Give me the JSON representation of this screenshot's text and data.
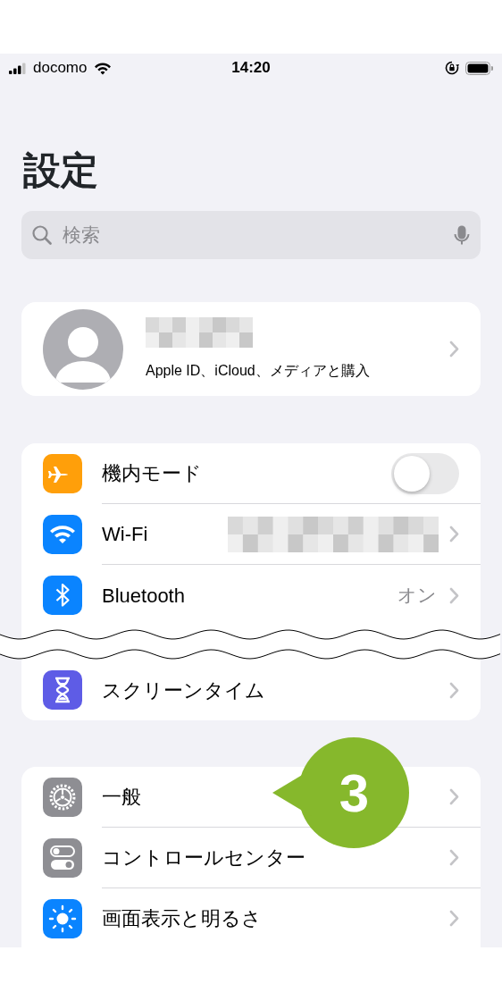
{
  "status_bar": {
    "carrier": "docomo",
    "time": "14:20"
  },
  "title": "設定",
  "search": {
    "placeholder": "検索"
  },
  "profile": {
    "name_masked": true,
    "subtitle": "Apple ID、iCloud、メディアと購入"
  },
  "groups": [
    {
      "clipped": false,
      "rows": [
        {
          "kind": "toggle",
          "label": "機内モード",
          "color": "#ff9f0a",
          "on": false
        },
        {
          "kind": "link",
          "label": "Wi-Fi",
          "color": "#0a84ff",
          "masked": true
        },
        {
          "kind": "link",
          "label": "Bluetooth",
          "color": "#0a84ff",
          "value": "オン",
          "masked": false
        },
        {
          "kind": "break"
        },
        {
          "kind": "link",
          "label": "スクリーンタイム",
          "color": "#5e5ce6",
          "masked": false
        }
      ]
    },
    {
      "clipped": true,
      "rows": [
        {
          "kind": "link",
          "label": "一般",
          "color": "#8e8e93",
          "masked": false
        },
        {
          "kind": "link",
          "label": "コントロールセンター",
          "color": "#8e8e93",
          "masked": false
        },
        {
          "kind": "link",
          "label": "画面表示と明るさ",
          "color": "#0a84ff",
          "masked": false
        }
      ]
    }
  ],
  "callout": {
    "label": "3"
  }
}
